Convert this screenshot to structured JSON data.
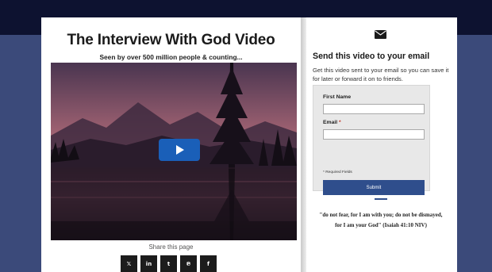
{
  "header": {
    "title": "The Interview With God Video",
    "subtitle": "Seen by over 500 million people & counting..."
  },
  "video": {
    "play_icon": "play-icon"
  },
  "share": {
    "label": "Share this page",
    "buttons": [
      {
        "icon": "x-icon",
        "glyph": "𝕏"
      },
      {
        "icon": "linkedin-icon",
        "glyph": "in"
      },
      {
        "icon": "tumblr-icon",
        "glyph": "t"
      },
      {
        "icon": "pinterest-icon",
        "glyph": "℗"
      },
      {
        "icon": "facebook-icon",
        "glyph": "f"
      }
    ]
  },
  "email_form": {
    "icon": "envelope-icon",
    "title": "Send this video to your email",
    "description": "Get this video sent to your email so you can save it for later or forward it on to friends.",
    "first_name_label": "First Name",
    "email_label": "Email",
    "required_star": "*",
    "required_note": "* Required Fields",
    "submit_label": "Submit"
  },
  "verse": {
    "line1": "\"do not fear, for I am with you; do not be dismayed,",
    "line2": "for I am your God\" (Isaiah 41:10 NIV)"
  },
  "colors": {
    "page_background": "#3b4a7a",
    "top_band": "#0d1230",
    "play_button": "#1a5fb8",
    "submit_button": "#2f4e8c",
    "share_button": "#1c1c1c"
  }
}
